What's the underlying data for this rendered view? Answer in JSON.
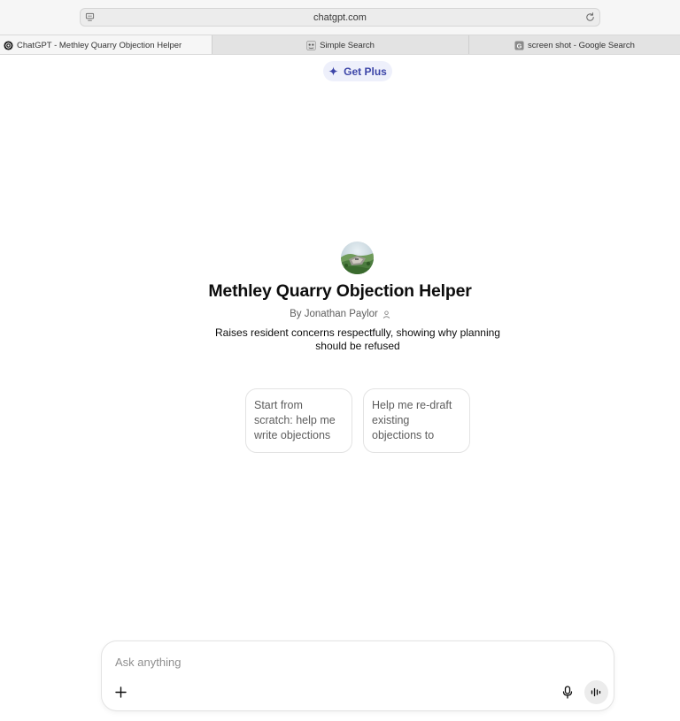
{
  "browser": {
    "url": "chatgpt.com",
    "tabs": [
      {
        "title": "ChatGPT - Methley Quarry Objection Helper",
        "icon": "chatgpt-logo-icon",
        "active": true
      },
      {
        "title": "Simple Search",
        "icon": "simple-search-favicon-icon",
        "active": false
      },
      {
        "title": "screen shot - Google Search",
        "icon": "google-favicon-icon",
        "active": false
      }
    ]
  },
  "header": {
    "get_plus_label": "Get Plus",
    "accent_color": "#3d46a8"
  },
  "gpt": {
    "title": "Methley Quarry Objection Helper",
    "byline": "By Jonathan Paylor",
    "description": "Raises resident concerns respectfully, showing why planning should be refused"
  },
  "starters": [
    {
      "label": "Start from scratch: help me write objections to..."
    },
    {
      "label": "Help me re-draft existing objections to Methley Quarry"
    }
  ],
  "composer": {
    "placeholder": "Ask anything",
    "value": ""
  }
}
